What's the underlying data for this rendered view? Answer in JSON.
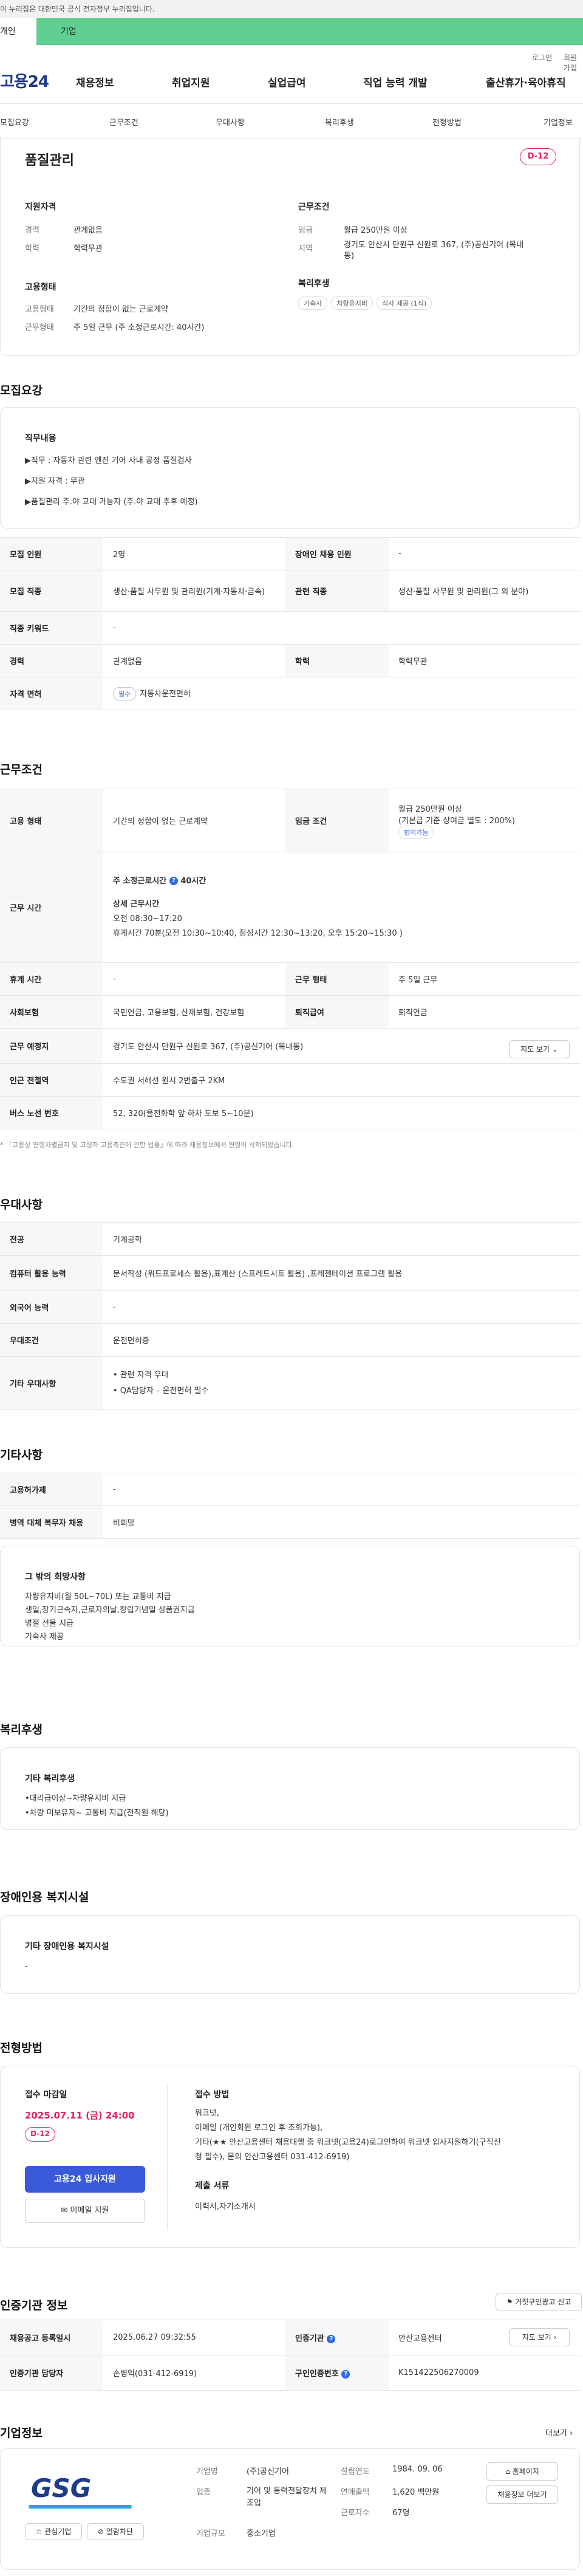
{
  "gov_banner": "이 누리집은 대한민국 공식 전자정부 누리집입니다.",
  "tabs": {
    "a": "개인",
    "b": "기업"
  },
  "util": {
    "login": "로그인",
    "join": "회원가입"
  },
  "logo": "고용24",
  "gnb": [
    "채용정보",
    "취업지원",
    "실업급여",
    "직업 능력 개발",
    "출산휴가·육아휴직"
  ],
  "anchors": [
    "모집요강",
    "근무조건",
    "우대사항",
    "복리후생",
    "전형방법",
    "기업정보"
  ],
  "header": {
    "title": "품질관리",
    "dday": "D-12",
    "qual_h": "지원자격",
    "career_l": "경력",
    "career_v": "관계없음",
    "edu_l": "학력",
    "edu_v": "학력무관",
    "cond_h": "근무조건",
    "pay_l": "임금",
    "pay_v": "월급 250만원 이상",
    "loc_l": "지역",
    "loc_v1": "경기도 안산시 단원구 신원로 367, (주)공신기어 (목내",
    "loc_v2": "동)",
    "emp_h": "고용형태",
    "emp_l": "고용형태",
    "emp_v": "기간의 정함이 없는 근로계약",
    "week_l": "근무형태",
    "week_v": "주 5일 근무 (주 소정근로시간: 40시간)",
    "ben_h": "복리후생",
    "ben_tags": [
      "기숙사",
      "차량유지비",
      "식사 제공 (1식)"
    ]
  },
  "recruit": {
    "title": "모집요강",
    "duty_h": "직무내용",
    "duty": [
      "▶직무 : 자동차 관련 엔진 기어 사내 공정 품질검사",
      "▶지원 자격 : 무관",
      "▶품질관리 주.야 교대 가능자 (주.야 교대 추후 예정)"
    ],
    "rows": [
      [
        "모집 인원",
        "2명",
        "장애인 채용 인원",
        "-"
      ],
      [
        "모집 직종",
        "생산·품질 사무원 및 관리원(기계·자동차·금속)",
        "관련 직종",
        "생산·품질 사무원 및 관리원(그 외 분야)"
      ],
      [
        "직종 키워드",
        "-",
        "",
        ""
      ],
      [
        "경력",
        "관계없음",
        "학력",
        "학력무관"
      ]
    ],
    "license_l": "자격 면허",
    "license_tag": "필수",
    "license_v": "자동차운전면허"
  },
  "work": {
    "title": "근무조건",
    "emp_l": "고용 형태",
    "emp_v": "기간의 정함이 없는 근로계약",
    "wage_l": "임금 조건",
    "wage_v1": "월급 250만원 이상",
    "wage_v2": "(기본급 기준 상여금 별도 : 200%)",
    "wage_tag": "협의가능",
    "time_l": "근무 시간",
    "time_a": "주 소정근로시간",
    "time_b": "40시간",
    "time_h": "상세 근무시간",
    "time_1": "오전 08:30~17:20",
    "time_2": "휴게시간 70분(오전 10:30~10:40, 점심시간 12:30~13:20, 오후 15:20~15:30 )",
    "rows": [
      [
        "휴게 시간",
        "-",
        "근무 형태",
        "주 5일 근무"
      ],
      [
        "사회보험",
        "국민연금, 고용보험, 산재보험, 건강보험",
        "퇴직급여",
        "퇴직연금"
      ]
    ],
    "place_l": "근무 예정지",
    "place_v": "경기도 안산시 단원구 신원로 367, (주)공신기어 (목내동)",
    "map_btn": "지도 보기",
    "station_l": "인근 전철역",
    "station_v": "수도권 서해선 원시 2번출구 2KM",
    "bus_l": "버스 노선 번호",
    "bus_v": "52, 320(율전화학 앞 하차 도보 5~10분)",
    "note": "* 「고용상 연령차별금지 및 고령자 고용촉진에 관한 법률」에 따라 채용정보에서 연령이 삭제되었습니다."
  },
  "pref": {
    "title": "우대사항",
    "rows": [
      [
        "전공",
        "기계공학"
      ],
      [
        "컴퓨터 활용 능력",
        "문서작성 (워드프로세스 활용),표계산 (스프레드시트 활용) ,프레젠테이션 프로그램 활용"
      ],
      [
        "외국어 능력",
        "-"
      ],
      [
        "우대조건",
        "운전면허증"
      ]
    ],
    "etc_l": "기타 우대사항",
    "etc": [
      "• 관련 자격 우대",
      "• QA담당자 – 운전면허 필수"
    ]
  },
  "other": {
    "title": "기타사항",
    "rows": [
      [
        "고용허가제",
        "-"
      ],
      [
        "병역 대체 복무자 채용",
        "비희망"
      ]
    ],
    "hope_h": "그 밖의 희망사항",
    "hope": [
      "차량유지비(월 50L~70L) 또는 교통비 지급",
      "생일,장기근속자,근로자의날,창립기념일 상품권지급",
      "명절 선물 지급",
      "기숙사 제공"
    ]
  },
  "welfare": {
    "title": "복리후생",
    "h": "기타 복리후생",
    "items": [
      "•대리급이상~차량유지비 지급",
      "•차량 미보유자~ 교통비 지급(전직원 해당)"
    ]
  },
  "disabled": {
    "title": "장애인용 복지시설",
    "h": "기타 장애인용 복지시설",
    "v": "-"
  },
  "selection": {
    "title": "전형방법",
    "deadline_h": "접수 마감일",
    "deadline": "2025.07.11 (금) 24:00",
    "dday": "D-12",
    "apply": "고용24 입사지원",
    "email": "이메일 지원",
    "method_h": "접수 방법",
    "method": [
      "워크넷,",
      "이메일 (개인회원 로그인 후 조회가능),",
      "기타(★★ 안산고용센터 채용대행 중 워크넷(고용24)로그인하여 워크넷 입사지원하기(구직신",
      "청 필수), 문의 안산고용센터 031-412-6919)"
    ],
    "docs_h": "제출 서류",
    "docs": "이력서,자기소개서"
  },
  "cert": {
    "title": "인증기관 정보",
    "report": "거짓구인광고 신고",
    "reg_l": "채용공고 등록일시",
    "reg_v": "2025.06.27 09:32:55",
    "org_l": "인증기관",
    "org_v": "안산고용센터",
    "map_btn": "지도 보기",
    "mgr_l": "인증기관 담당자",
    "mgr_v": "손병익(031-412-6919)",
    "no_l": "구인인증번호",
    "no_v": "K151422506270009"
  },
  "company": {
    "title": "기업정보",
    "more": "더보기",
    "logo": "GSG",
    "fav": "관심기업",
    "block": "열람차단",
    "rows": [
      [
        "기업명",
        "(주)공신기어",
        "설립연도",
        "1984. 09. 06"
      ],
      [
        "업종",
        "기어 및 동력전달장치 제조업",
        "연매출액",
        "1,620 백만원"
      ],
      [
        "",
        "",
        "근로자수",
        "67명"
      ],
      [
        "기업규모",
        "중소기업",
        "",
        ""
      ]
    ],
    "home": "홈페이지",
    "list": "채용정보 더보기"
  },
  "colors": {
    "green": "#5ecf91",
    "blue": "#3a5bd9",
    "red": "#e0245e"
  }
}
